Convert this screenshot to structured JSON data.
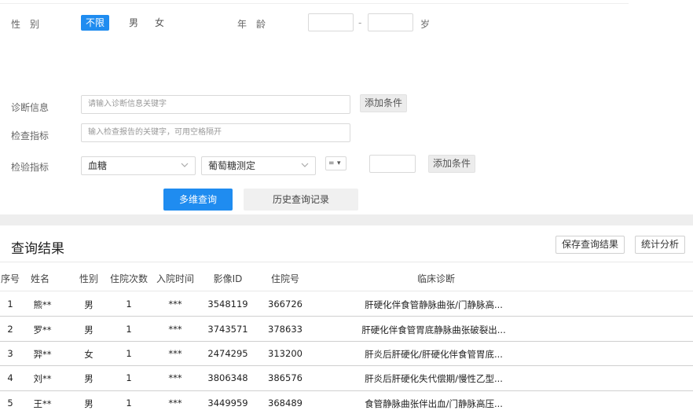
{
  "filters": {
    "gender": {
      "label": "性　别",
      "options": [
        "不限",
        "男",
        "女"
      ],
      "selected": "不限"
    },
    "age": {
      "label": "年　龄",
      "min": "",
      "max": "",
      "dash": "-",
      "unit": "岁"
    }
  },
  "diagnosis": {
    "label": "诊断信息",
    "placeholder": "请输入诊断信息关键字",
    "add_label": "添加条件"
  },
  "exam": {
    "label": "检查指标",
    "placeholder": "输入检查报告的关键字，可用空格隔开"
  },
  "lab": {
    "label": "检验指标",
    "category": "血糖",
    "item": "葡萄糖测定",
    "operator": "=",
    "operator_arrow": "▾",
    "value": "",
    "add_label": "添加条件"
  },
  "actions": {
    "query_label": "多维查询",
    "history_label": "历史查询记录"
  },
  "results": {
    "title": "查询结果",
    "save_label": "保存查询结果",
    "stats_label": "统计分析",
    "columns": [
      "序号",
      "姓名",
      "性别",
      "住院次数",
      "入院时间",
      "影像ID",
      "住院号",
      "临床诊断"
    ],
    "rows": [
      {
        "no": "1",
        "name": "熊**",
        "gender": "男",
        "visits": "1",
        "admit": "***",
        "image_id": "3548119",
        "hosp_no": "366726",
        "diagnosis": "肝硬化伴食管静脉曲张/门静脉高..."
      },
      {
        "no": "2",
        "name": "罗**",
        "gender": "男",
        "visits": "1",
        "admit": "***",
        "image_id": "3743571",
        "hosp_no": "378633",
        "diagnosis": "肝硬化伴食管胃底静脉曲张破裂出..."
      },
      {
        "no": "3",
        "name": "羿**",
        "gender": "女",
        "visits": "1",
        "admit": "***",
        "image_id": "2474295",
        "hosp_no": "313200",
        "diagnosis": "肝炎后肝硬化/肝硬化伴食管胃底..."
      },
      {
        "no": "4",
        "name": "刘**",
        "gender": "男",
        "visits": "1",
        "admit": "***",
        "image_id": "3806348",
        "hosp_no": "386576",
        "diagnosis": "肝炎后肝硬化失代偿期/慢性乙型..."
      },
      {
        "no": "5",
        "name": "王**",
        "gender": "男",
        "visits": "1",
        "admit": "***",
        "image_id": "3449959",
        "hosp_no": "368489",
        "diagnosis": "食管静脉曲张伴出血/门静脉高压..."
      }
    ]
  },
  "icons": {
    "chevron": "chevron-down-icon"
  },
  "colors": {
    "accent": "#1f8cf0"
  }
}
